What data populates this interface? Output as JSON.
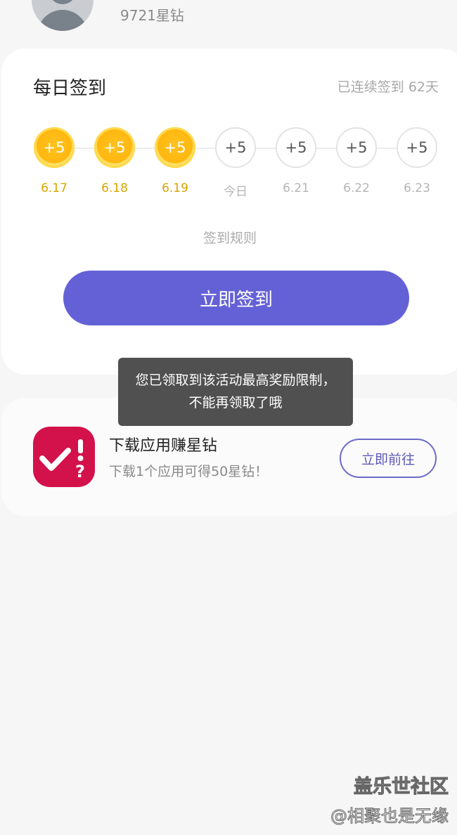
{
  "profile": {
    "points": "9721星钻"
  },
  "checkin": {
    "title": "每日签到",
    "streak": "已连续签到 62天",
    "days": [
      {
        "reward": "+5",
        "label": "6.17",
        "checked": true
      },
      {
        "reward": "+5",
        "label": "6.18",
        "checked": true
      },
      {
        "reward": "+5",
        "label": "6.19",
        "checked": true
      },
      {
        "reward": "+5",
        "label": "今日",
        "checked": false
      },
      {
        "reward": "+5",
        "label": "6.21",
        "checked": false
      },
      {
        "reward": "+5",
        "label": "6.22",
        "checked": false
      },
      {
        "reward": "+5",
        "label": "6.23",
        "checked": false
      }
    ],
    "rules_label": "签到规则",
    "button_label": "立即签到"
  },
  "toast": {
    "text": "您已领取到该活动最高奖励限制，不能再领取了哦"
  },
  "task": {
    "icon": "checkmark-question-icon",
    "title": "下载应用赚星钻",
    "subtitle": "下载1个应用可得50星钻！",
    "button_label": "立即前往"
  },
  "watermark": {
    "line1": "盖乐世社区",
    "line2": "@相聚也是无缘"
  },
  "colors": {
    "accent": "#6461d6",
    "coin": "#ffb70f",
    "checked_label": "#d8a400",
    "app_icon": "#d3114a",
    "toast_bg": "#505050"
  }
}
